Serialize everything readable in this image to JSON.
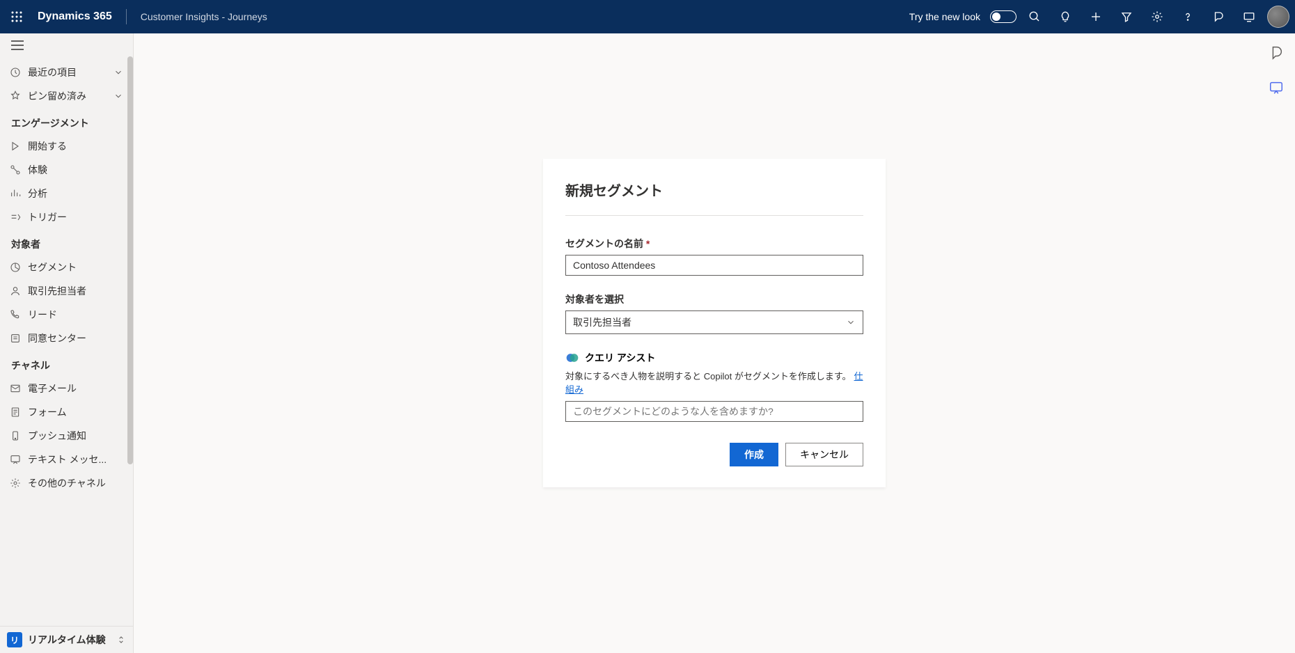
{
  "topbar": {
    "brand": "Dynamics 365",
    "subtitle": "Customer Insights - Journeys",
    "tryNew": "Try the new look"
  },
  "sidebar": {
    "recent": "最近の項目",
    "pinned": "ピン留め済み",
    "sections": {
      "engagement": "エンゲージメント",
      "audience": "対象者",
      "channel": "チャネル"
    },
    "items": {
      "getStarted": "開始する",
      "experience": "体験",
      "analytics": "分析",
      "triggers": "トリガー",
      "segments": "セグメント",
      "contacts": "取引先担当者",
      "leads": "リード",
      "consent": "同意センター",
      "emails": "電子メール",
      "forms": "フォーム",
      "push": "プッシュ通知",
      "text": "テキスト メッセ...",
      "otherChannels": "その他のチャネル"
    },
    "areaBadge": "リ",
    "areaLabel": "リアルタイム体験"
  },
  "dialog": {
    "title": "新規セグメント",
    "nameLabel": "セグメントの名前",
    "nameValue": "Contoso Attendees",
    "audienceLabel": "対象者を選択",
    "audienceValue": "取引先担当者",
    "assistTitle": "クエリ アシスト",
    "assistDesc": "対象にするべき人物を説明すると Copilot がセグメントを作成します。",
    "assistLink": "仕組み",
    "assistPlaceholder": "このセグメントにどのような人を含めますか?",
    "createBtn": "作成",
    "cancelBtn": "キャンセル"
  }
}
